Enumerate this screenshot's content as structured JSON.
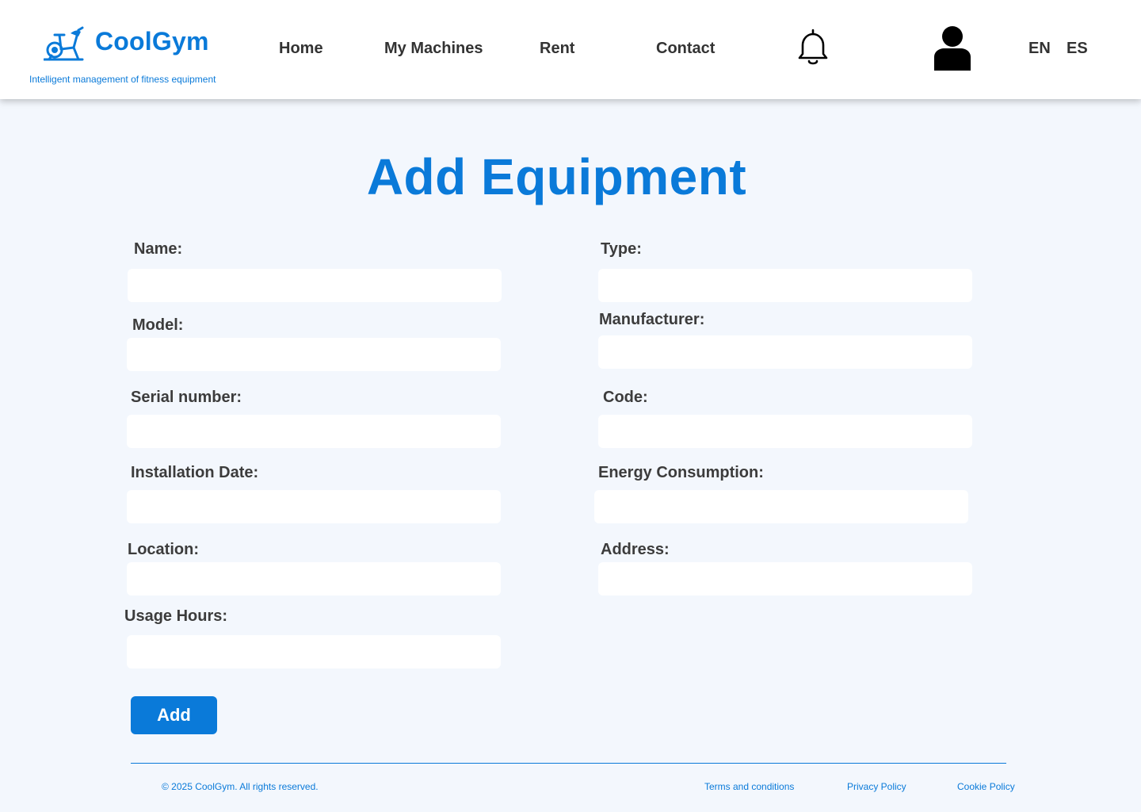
{
  "header": {
    "logo_text": "CoolGym",
    "tagline": "Intelligent management of fitness equipment",
    "nav": {
      "home": "Home",
      "my_machines": "My Machines",
      "rent": "Rent",
      "contact": "Contact"
    },
    "languages": {
      "en": "EN",
      "es": "ES"
    },
    "icons": {
      "logo": "exercise-bike-icon",
      "notifications": "bell-icon",
      "profile": "user-icon"
    }
  },
  "main": {
    "title": "Add Equipment",
    "fields": {
      "name": {
        "label": "Name:",
        "value": ""
      },
      "type": {
        "label": "Type:",
        "value": ""
      },
      "model": {
        "label": "Model:",
        "value": ""
      },
      "manufacturer": {
        "label": "Manufacturer:",
        "value": ""
      },
      "serial_number": {
        "label": "Serial number:",
        "value": ""
      },
      "code": {
        "label": "Code:",
        "value": ""
      },
      "installation_date": {
        "label": "Installation Date:",
        "value": ""
      },
      "energy_consumption": {
        "label": "Energy Consumption:",
        "value": ""
      },
      "location": {
        "label": "Location:",
        "value": ""
      },
      "address": {
        "label": "Address:",
        "value": ""
      },
      "usage_hours": {
        "label": "Usage Hours:",
        "value": ""
      }
    },
    "add_button": "Add"
  },
  "footer": {
    "copyright": "© 2025 CoolGym. All rights reserved.",
    "links": {
      "terms": "Terms and conditions",
      "privacy": "Privacy Policy",
      "cookie": "Cookie Policy"
    }
  },
  "colors": {
    "brand": "#0a7ad9",
    "background": "#f3f7fd",
    "text": "#333333"
  }
}
